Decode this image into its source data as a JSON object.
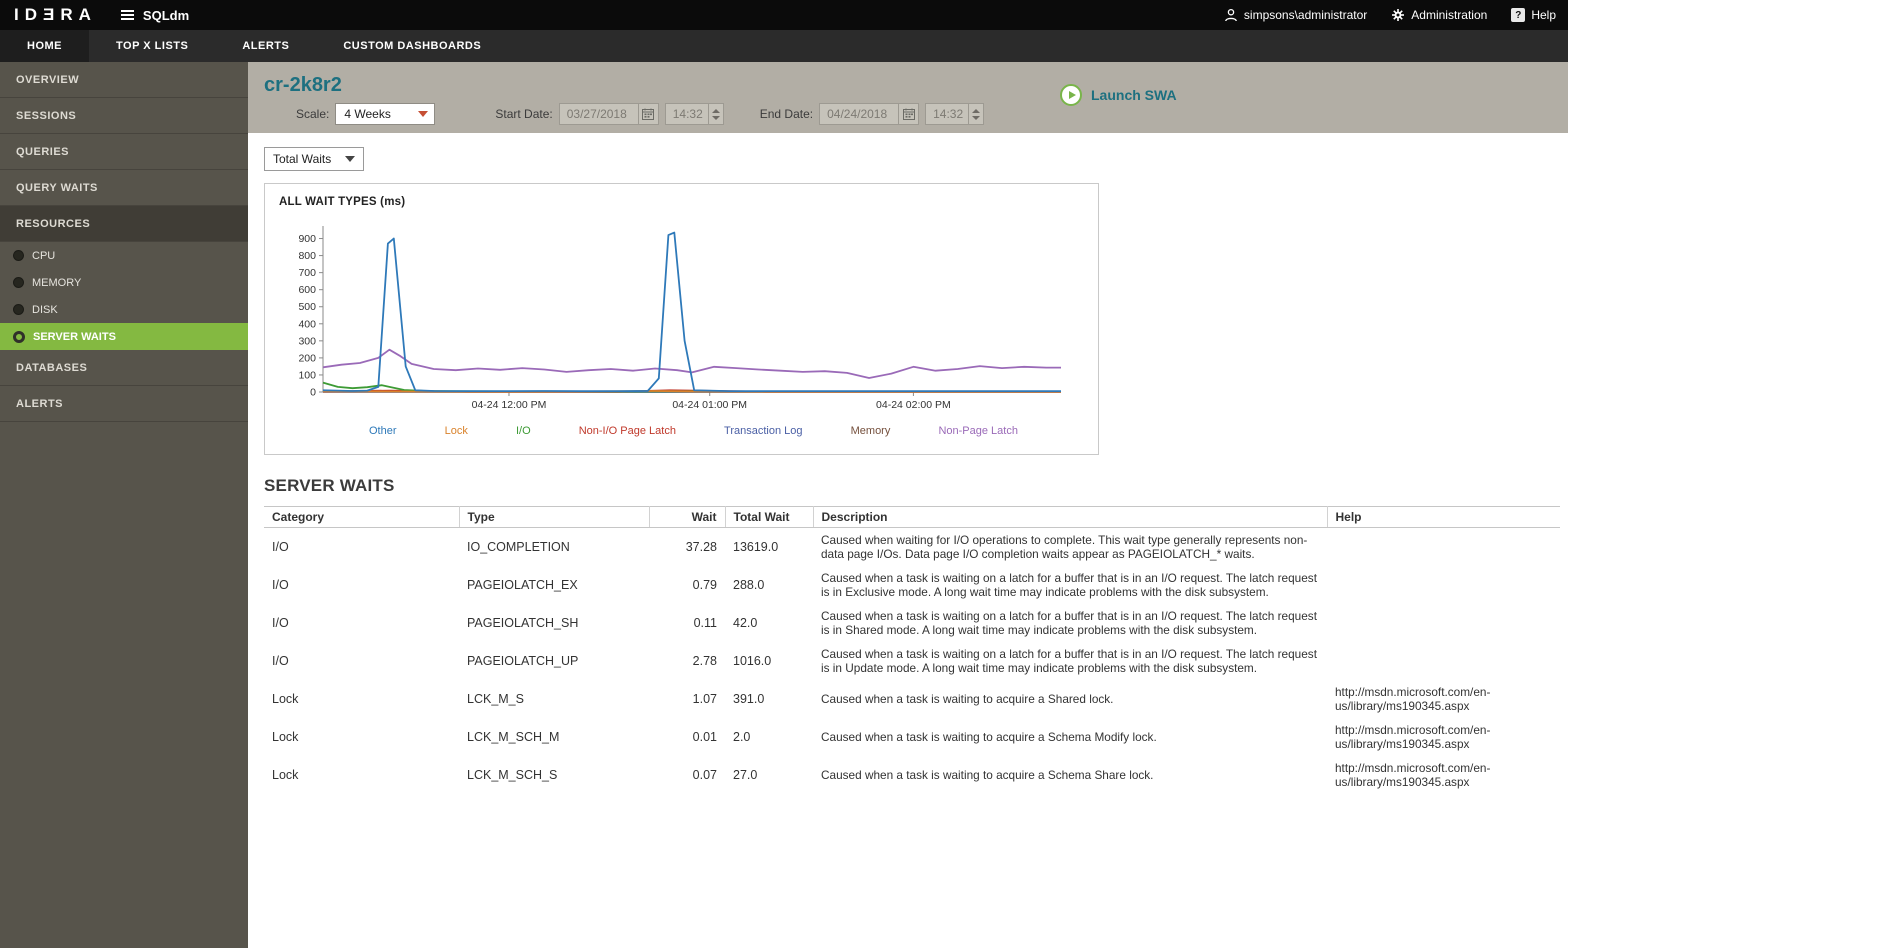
{
  "topbar": {
    "logo": "IDƎRA",
    "product": "SQLdm",
    "user": "simpsons\\administrator",
    "administration": "Administration",
    "help": "Help"
  },
  "nav": {
    "items": [
      {
        "label": "HOME",
        "active": true
      },
      {
        "label": "TOP X LISTS",
        "active": false
      },
      {
        "label": "ALERTS",
        "active": false
      },
      {
        "label": "CUSTOM DASHBOARDS",
        "active": false
      }
    ]
  },
  "sidebar": {
    "items": [
      {
        "label": "OVERVIEW"
      },
      {
        "label": "SESSIONS"
      },
      {
        "label": "QUERIES"
      },
      {
        "label": "QUERY WAITS"
      },
      {
        "label": "RESOURCES",
        "expanded": true,
        "children": [
          {
            "label": "CPU",
            "selected": false
          },
          {
            "label": "MEMORY",
            "selected": false
          },
          {
            "label": "DISK",
            "selected": false
          },
          {
            "label": "SERVER WAITS",
            "selected": true
          }
        ]
      },
      {
        "label": "DATABASES"
      },
      {
        "label": "ALERTS"
      }
    ]
  },
  "header": {
    "title": "cr-2k8r2",
    "scale": {
      "label": "Scale:",
      "value": "4 Weeks"
    },
    "start": {
      "label": "Start Date:",
      "date": "03/27/2018",
      "time": "14:32"
    },
    "end": {
      "label": "End Date:",
      "date": "04/24/2018",
      "time": "14:32"
    },
    "launch_swa_label": "Launch SWA"
  },
  "waits_filter": {
    "value": "Total Waits"
  },
  "chart_data": {
    "type": "line",
    "title": "ALL WAIT TYPES (ms)",
    "ylabel": "",
    "xlabel": "",
    "ylim": [
      0,
      950
    ],
    "yticks": [
      0,
      100,
      200,
      300,
      400,
      500,
      600,
      700,
      800,
      900
    ],
    "xticks": [
      {
        "pos": 0.252,
        "label": "04-24 12:00 PM"
      },
      {
        "pos": 0.524,
        "label": "04-24 01:00 PM"
      },
      {
        "pos": 0.8,
        "label": "04-24 02:00 PM"
      }
    ],
    "grid": false,
    "legend_position": "bottom",
    "series": [
      {
        "name": "Other",
        "color": "#2e79b9",
        "points": [
          [
            0,
            10
          ],
          [
            0.02,
            8
          ],
          [
            0.04,
            6
          ],
          [
            0.06,
            8
          ],
          [
            0.075,
            30
          ],
          [
            0.088,
            870
          ],
          [
            0.096,
            900
          ],
          [
            0.112,
            150
          ],
          [
            0.125,
            10
          ],
          [
            0.15,
            6
          ],
          [
            0.2,
            5
          ],
          [
            0.25,
            5
          ],
          [
            0.3,
            6
          ],
          [
            0.35,
            5
          ],
          [
            0.4,
            5
          ],
          [
            0.44,
            6
          ],
          [
            0.455,
            80
          ],
          [
            0.468,
            920
          ],
          [
            0.476,
            935
          ],
          [
            0.49,
            300
          ],
          [
            0.503,
            10
          ],
          [
            0.55,
            5
          ],
          [
            0.6,
            5
          ],
          [
            0.65,
            5
          ],
          [
            0.7,
            5
          ],
          [
            0.75,
            5
          ],
          [
            0.8,
            5
          ],
          [
            0.85,
            5
          ],
          [
            0.9,
            5
          ],
          [
            0.95,
            5
          ],
          [
            1,
            5
          ]
        ]
      },
      {
        "name": "Lock",
        "color": "#d9822b",
        "points": [
          [
            0,
            4
          ],
          [
            0.1,
            3
          ],
          [
            0.2,
            2
          ],
          [
            0.3,
            2
          ],
          [
            0.45,
            6
          ],
          [
            0.5,
            3
          ],
          [
            0.6,
            2
          ],
          [
            0.7,
            2
          ],
          [
            0.8,
            2
          ],
          [
            0.9,
            2
          ],
          [
            1,
            2
          ]
        ]
      },
      {
        "name": "I/O",
        "color": "#3d9b35",
        "points": [
          [
            0,
            55
          ],
          [
            0.02,
            30
          ],
          [
            0.04,
            22
          ],
          [
            0.06,
            28
          ],
          [
            0.08,
            40
          ],
          [
            0.09,
            30
          ],
          [
            0.11,
            12
          ],
          [
            0.14,
            6
          ],
          [
            0.2,
            4
          ],
          [
            0.3,
            3
          ],
          [
            0.4,
            3
          ],
          [
            0.5,
            4
          ],
          [
            0.6,
            3
          ],
          [
            0.7,
            3
          ],
          [
            0.8,
            3
          ],
          [
            0.9,
            3
          ],
          [
            1,
            3
          ]
        ]
      },
      {
        "name": "Non-I/O Page Latch",
        "color": "#c0392b",
        "points": [
          [
            0,
            3
          ],
          [
            0.09,
            8
          ],
          [
            0.2,
            2
          ],
          [
            0.4,
            2
          ],
          [
            0.47,
            10
          ],
          [
            0.6,
            2
          ],
          [
            0.8,
            2
          ],
          [
            1,
            2
          ]
        ]
      },
      {
        "name": "Transaction Log",
        "color": "#4a5fa5",
        "points": [
          [
            0,
            2
          ],
          [
            0.2,
            1
          ],
          [
            0.4,
            1
          ],
          [
            0.6,
            1
          ],
          [
            0.8,
            1
          ],
          [
            1,
            1
          ]
        ]
      },
      {
        "name": "Memory",
        "color": "#75503d",
        "points": [
          [
            0,
            1
          ],
          [
            0.5,
            1
          ],
          [
            1,
            1
          ]
        ]
      },
      {
        "name": "Non-Page Latch",
        "color": "#9a6ab8",
        "points": [
          [
            0,
            145
          ],
          [
            0.025,
            160
          ],
          [
            0.05,
            170
          ],
          [
            0.075,
            200
          ],
          [
            0.09,
            248
          ],
          [
            0.105,
            210
          ],
          [
            0.12,
            165
          ],
          [
            0.15,
            135
          ],
          [
            0.18,
            128
          ],
          [
            0.21,
            138
          ],
          [
            0.24,
            130
          ],
          [
            0.27,
            140
          ],
          [
            0.3,
            132
          ],
          [
            0.33,
            118
          ],
          [
            0.36,
            128
          ],
          [
            0.39,
            135
          ],
          [
            0.42,
            125
          ],
          [
            0.45,
            138
          ],
          [
            0.48,
            128
          ],
          [
            0.5,
            115
          ],
          [
            0.53,
            148
          ],
          [
            0.56,
            140
          ],
          [
            0.59,
            132
          ],
          [
            0.62,
            125
          ],
          [
            0.65,
            118
          ],
          [
            0.68,
            122
          ],
          [
            0.71,
            112
          ],
          [
            0.74,
            82
          ],
          [
            0.77,
            108
          ],
          [
            0.8,
            148
          ],
          [
            0.83,
            125
          ],
          [
            0.86,
            135
          ],
          [
            0.89,
            152
          ],
          [
            0.92,
            140
          ],
          [
            0.95,
            148
          ],
          [
            0.98,
            143
          ],
          [
            1,
            143
          ]
        ]
      }
    ]
  },
  "table": {
    "section_title": "SERVER WAITS",
    "columns": [
      "Category",
      "Type",
      "Wait",
      "Total Wait",
      "Description",
      "Help"
    ],
    "rows": [
      {
        "category": "I/O",
        "type": "IO_COMPLETION",
        "wait": "37.28",
        "total_wait": "13619.0",
        "description": "Caused when waiting for I/O operations to complete. This wait type generally represents non-data page I/Os. Data page I/O completion waits appear as PAGEIOLATCH_* waits.",
        "help": ""
      },
      {
        "category": "I/O",
        "type": "PAGEIOLATCH_EX",
        "wait": "0.79",
        "total_wait": "288.0",
        "description": "Caused when a task is waiting on a latch for a buffer that is in an I/O request. The latch request is in Exclusive mode. A long wait time may indicate problems with the disk subsystem.",
        "help": ""
      },
      {
        "category": "I/O",
        "type": "PAGEIOLATCH_SH",
        "wait": "0.11",
        "total_wait": "42.0",
        "description": "Caused when a task is waiting on a latch for a buffer that is in an I/O request. The latch request is in Shared mode. A long wait time may indicate problems with the disk subsystem.",
        "help": ""
      },
      {
        "category": "I/O",
        "type": "PAGEIOLATCH_UP",
        "wait": "2.78",
        "total_wait": "1016.0",
        "description": "Caused when a task is waiting on a latch for a buffer that is in an I/O request. The latch request is in Update mode. A long wait time may indicate problems with the disk subsystem.",
        "help": ""
      },
      {
        "category": "Lock",
        "type": "LCK_M_S",
        "wait": "1.07",
        "total_wait": "391.0",
        "description": "Caused when a task is waiting to acquire a Shared lock.",
        "help": "http://msdn.microsoft.com/en-us/library/ms190345.aspx"
      },
      {
        "category": "Lock",
        "type": "LCK_M_SCH_M",
        "wait": "0.01",
        "total_wait": "2.0",
        "description": "Caused when a task is waiting to acquire a Schema Modify lock.",
        "help": "http://msdn.microsoft.com/en-us/library/ms190345.aspx"
      },
      {
        "category": "Lock",
        "type": "LCK_M_SCH_S",
        "wait": "0.07",
        "total_wait": "27.0",
        "description": "Caused when a task is waiting to acquire a Schema Share lock.",
        "help": "http://msdn.microsoft.com/en-us/library/ms190345.aspx"
      }
    ]
  }
}
